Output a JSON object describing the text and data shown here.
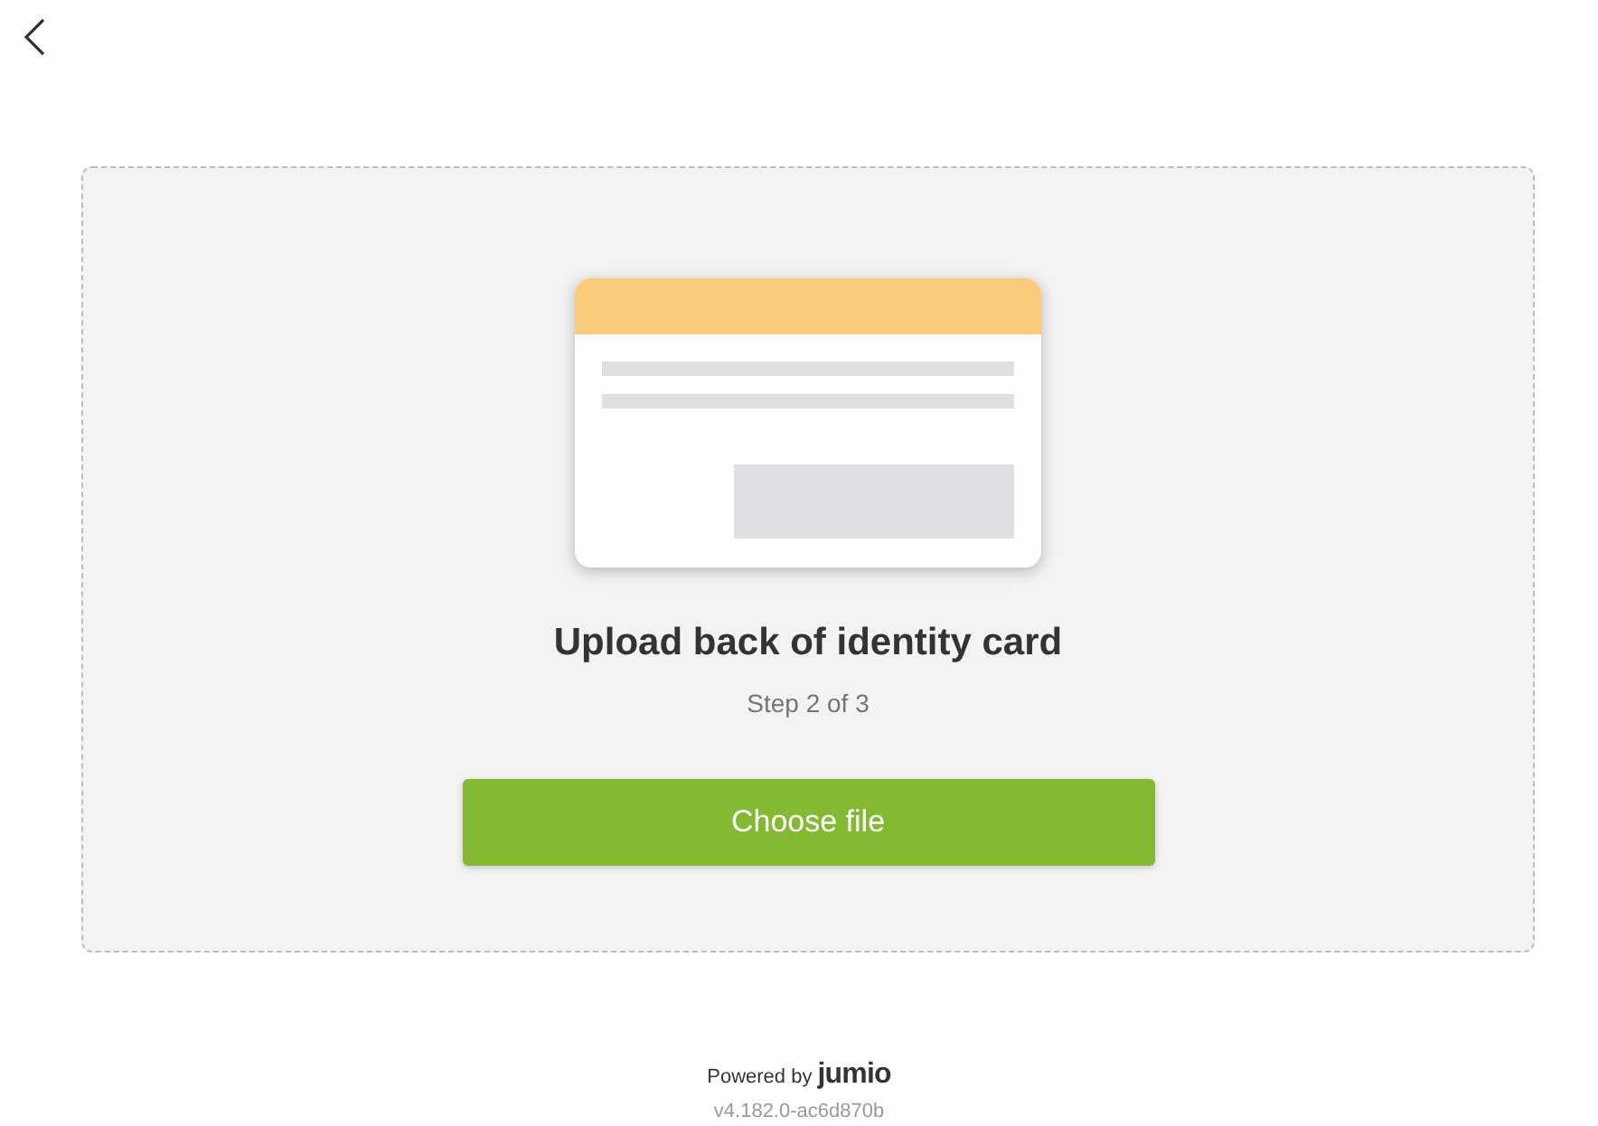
{
  "title": "Upload back of identity card",
  "step": "Step 2 of 3",
  "button": "Choose file",
  "footer": {
    "powered_by": "Powered by",
    "brand": "jumio",
    "version": "v4.182.0-ac6d870b"
  }
}
